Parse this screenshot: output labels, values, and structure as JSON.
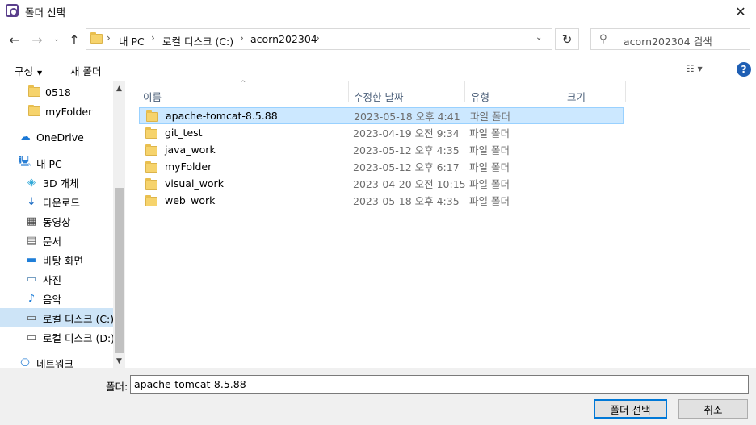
{
  "window": {
    "title": "폴더 선택",
    "close": "✕"
  },
  "address": {
    "back": "←",
    "forward": "→",
    "recent": "⌄",
    "up": "↑",
    "breadcrumb": [
      "내 PC",
      "로컬 디스크 (C:)",
      "acorn202304"
    ],
    "separator": "›",
    "dropdown": "⌄",
    "refresh": "↻",
    "search_placeholder": "acorn202304 검색"
  },
  "toolbar": {
    "organize": "구성",
    "organize_caret": "▼",
    "new_folder": "새 폴더",
    "view": "☷ ▾",
    "help": "?"
  },
  "nav": {
    "items": [
      {
        "label": "0518",
        "icon": "folder"
      },
      {
        "label": "myFolder",
        "icon": "folder"
      },
      {
        "label": "OneDrive",
        "icon": "cloud"
      },
      {
        "label": "내 PC",
        "icon": "pc"
      },
      {
        "label": "3D 개체",
        "icon": "3d"
      },
      {
        "label": "다운로드",
        "icon": "download"
      },
      {
        "label": "동영상",
        "icon": "video"
      },
      {
        "label": "문서",
        "icon": "document"
      },
      {
        "label": "바탕 화면",
        "icon": "desktop"
      },
      {
        "label": "사진",
        "icon": "picture"
      },
      {
        "label": "음악",
        "icon": "music"
      },
      {
        "label": "로컬 디스크 (C:)",
        "icon": "drive-c"
      },
      {
        "label": "로컬 디스크 (D:)",
        "icon": "drive"
      },
      {
        "label": "네트워크",
        "icon": "network"
      }
    ],
    "scroll_up": "▲",
    "scroll_down": "▼"
  },
  "files": {
    "columns": {
      "name": "이름",
      "date": "수정한 날짜",
      "type": "유형",
      "size": "크기"
    },
    "sort_arrow": "^",
    "rows": [
      {
        "name": "apache-tomcat-8.5.88",
        "date": "2023-05-18 오후 4:41",
        "type": "파일 폴더"
      },
      {
        "name": "git_test",
        "date": "2023-04-19 오전 9:34",
        "type": "파일 폴더"
      },
      {
        "name": "java_work",
        "date": "2023-05-12 오후 4:35",
        "type": "파일 폴더"
      },
      {
        "name": "myFolder",
        "date": "2023-05-12 오후 6:17",
        "type": "파일 폴더"
      },
      {
        "name": "visual_work",
        "date": "2023-04-20 오전 10:15",
        "type": "파일 폴더"
      },
      {
        "name": "web_work",
        "date": "2023-05-18 오후 4:35",
        "type": "파일 폴더"
      }
    ]
  },
  "bottom": {
    "folder_label": "폴더:",
    "folder_value": "apache-tomcat-8.5.88",
    "select_button": "폴더 선택",
    "cancel_button": "취소"
  },
  "colors": {
    "selection": "#cce8ff",
    "nav_selection": "#cde4f7",
    "accent": "#0078d7"
  }
}
